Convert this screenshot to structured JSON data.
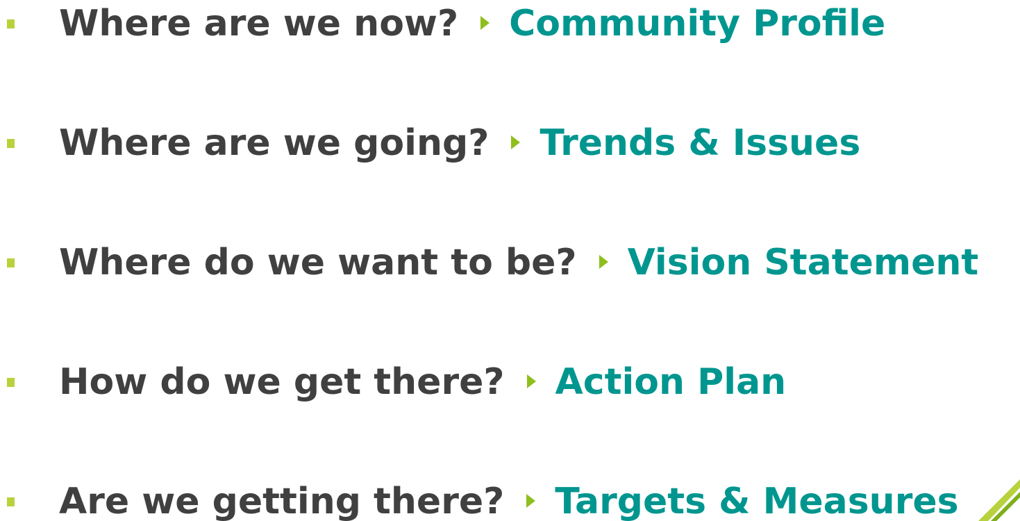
{
  "items": [
    {
      "question": "Where are we now?",
      "answer": "Community Profile"
    },
    {
      "question": "Where are we going?",
      "answer": "Trends & Issues"
    },
    {
      "question": "Where do we want to be?",
      "answer": "Vision Statement"
    },
    {
      "question": "How do we get there?",
      "answer": "Action Plan"
    },
    {
      "question": "Are we getting there?",
      "answer": "Targets & Measures"
    }
  ],
  "colors": {
    "question_text": "#404040",
    "answer_text": "#00968f",
    "bullet": "#b7d23c",
    "arrow": "#8fbf1e"
  }
}
